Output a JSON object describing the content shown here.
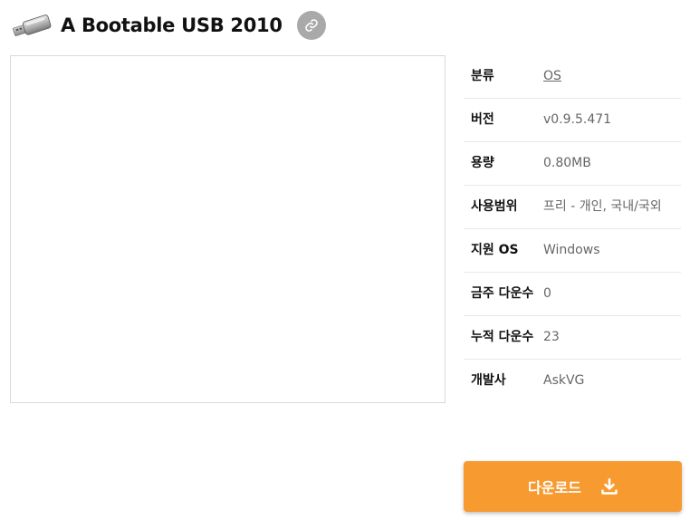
{
  "app": {
    "title": "A Bootable USB 2010",
    "icon": "usb-drive-icon",
    "link_icon": "link-icon"
  },
  "info": {
    "rows": [
      {
        "label": "분류",
        "value": "OS"
      },
      {
        "label": "버전",
        "value": "v0.9.5.471"
      },
      {
        "label": "용량",
        "value": "0.80MB"
      },
      {
        "label": "사용범위",
        "value": "프리 - 개인, 국내/국외"
      },
      {
        "label": "지원 OS",
        "value": "Windows"
      },
      {
        "label": "금주 다운수",
        "value": "0"
      },
      {
        "label": "누적 다운수",
        "value": "23"
      },
      {
        "label": "개발사",
        "value": "AskVG"
      }
    ]
  },
  "download": {
    "label": "다운로드",
    "icon": "download-icon",
    "color": "#f79a2f"
  }
}
